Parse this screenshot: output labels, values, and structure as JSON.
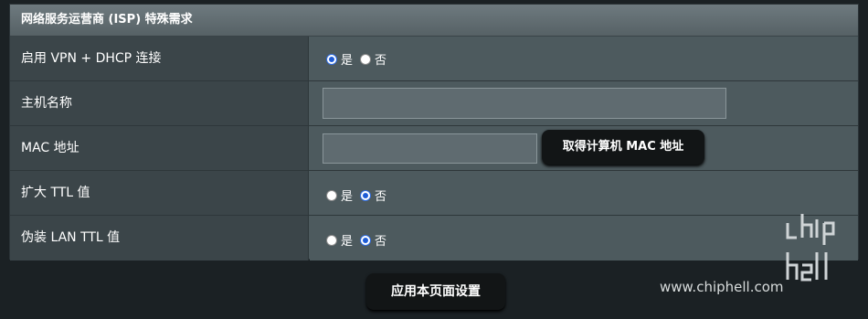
{
  "section": {
    "title": "网络服务运营商 (ISP) 特殊需求"
  },
  "rows": {
    "vpn_dhcp": {
      "label": "启用 VPN + DHCP 连接",
      "yes": "是",
      "no": "否",
      "selected": "yes"
    },
    "hostname": {
      "label": "主机名称",
      "value": ""
    },
    "mac": {
      "label": "MAC 地址",
      "value": "",
      "clone_button": "取得计算机 MAC 地址"
    },
    "ttl_extend": {
      "label": "扩大 TTL 值",
      "yes": "是",
      "no": "否",
      "selected": "no"
    },
    "ttl_spoof": {
      "label": "伪装 LAN TTL 值",
      "yes": "是",
      "no": "否",
      "selected": "no"
    }
  },
  "apply_button": "应用本页面设置",
  "watermark": {
    "url": "www.chiphell.com",
    "logo": "chiphell-logo"
  },
  "colors": {
    "radio_selected": "#1d5bd6",
    "panel": "#4d5a5e",
    "label_bg": "#3b4549"
  }
}
